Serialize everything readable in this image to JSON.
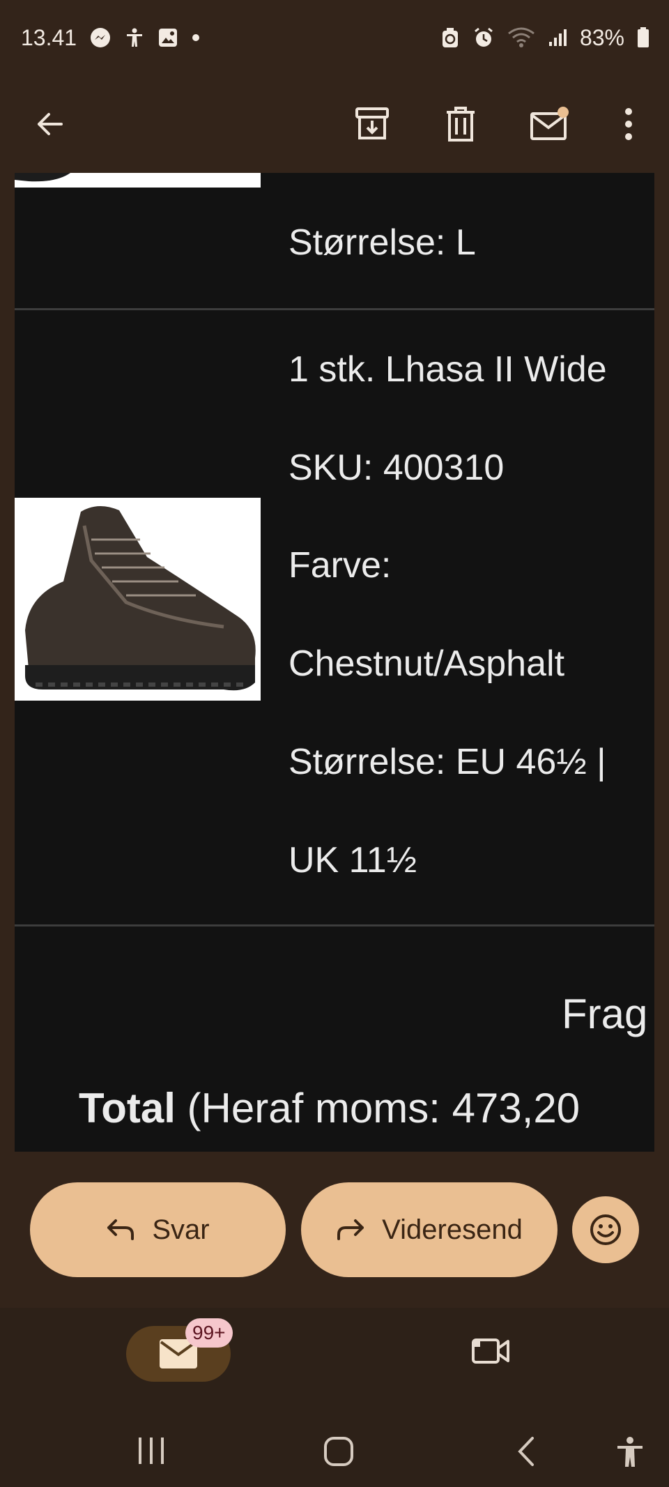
{
  "status_bar": {
    "time": "13.41",
    "battery": "83%",
    "left_icons": [
      "messenger-icon",
      "accessibility-icon",
      "gallery-icon",
      "dot-icon"
    ],
    "right_icons": [
      "sync-icon",
      "alarm-icon",
      "wifi-icon",
      "signal-icon",
      "battery-icon"
    ]
  },
  "toolbar": {
    "back": "back-arrow-icon",
    "actions": [
      "archive-icon",
      "delete-icon",
      "mark-unread-icon",
      "more-options-icon"
    ]
  },
  "email": {
    "item1": {
      "size": "Størrelse: L"
    },
    "item2": {
      "name": "1 stk. Lhasa II Wide",
      "sku": "SKU: 400310",
      "color_label": "Farve:",
      "color_value": "Chestnut/Asphalt",
      "size_line1": "Størrelse: EU 46½ |",
      "size_line2": "UK 11½"
    },
    "shipping_label": "Frag",
    "total_bold": "Total",
    "total_rest": " (Heraf moms: 473,20"
  },
  "actions": {
    "reply_label": "Svar",
    "forward_label": "Videresend"
  },
  "bottom_nav": {
    "mail_badge": "99+"
  },
  "colors": {
    "background": "#33241a",
    "email_bg": "#121212",
    "accent": "#eabf92",
    "badge_bg": "#f6c7cc"
  }
}
